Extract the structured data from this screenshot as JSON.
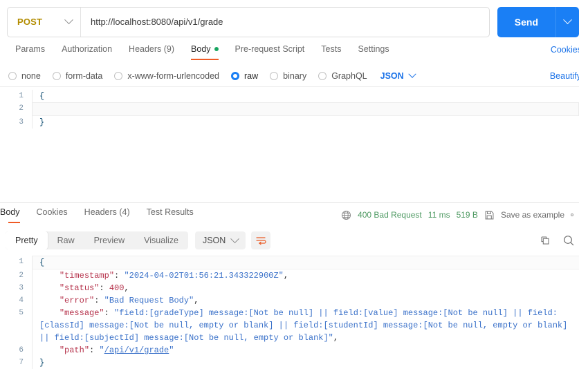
{
  "request": {
    "method": "POST",
    "url": "http://localhost:8080/api/v1/grade",
    "send_label": "Send",
    "tabs": [
      {
        "label": "Params",
        "active": false,
        "dot": false
      },
      {
        "label": "Authorization",
        "active": false,
        "dot": false
      },
      {
        "label": "Headers (9)",
        "active": false,
        "dot": false
      },
      {
        "label": "Body",
        "active": true,
        "dot": true
      },
      {
        "label": "Pre-request Script",
        "active": false,
        "dot": false
      },
      {
        "label": "Tests",
        "active": false,
        "dot": false
      },
      {
        "label": "Settings",
        "active": false,
        "dot": false
      }
    ],
    "cookies_link": "Cookies",
    "beautify_link": "Beautify",
    "body_types": [
      {
        "label": "none",
        "selected": false
      },
      {
        "label": "form-data",
        "selected": false
      },
      {
        "label": "x-www-form-urlencoded",
        "selected": false
      },
      {
        "label": "raw",
        "selected": true
      },
      {
        "label": "binary",
        "selected": false
      },
      {
        "label": "GraphQL",
        "selected": false
      }
    ],
    "raw_format": "JSON",
    "body_lines": [
      {
        "no": "1",
        "text": "{",
        "active": false
      },
      {
        "no": "2",
        "text": "",
        "active": true
      },
      {
        "no": "3",
        "text": "}",
        "active": false
      }
    ]
  },
  "response": {
    "tabs": [
      {
        "label": "Body",
        "active": true
      },
      {
        "label": "Cookies",
        "active": false
      },
      {
        "label": "Headers (4)",
        "active": false
      },
      {
        "label": "Test Results",
        "active": false
      }
    ],
    "status_text": "400 Bad Request",
    "time": "11 ms",
    "size": "519 B",
    "save_as_example": "Save as example",
    "view_modes": [
      {
        "label": "Pretty",
        "active": true
      },
      {
        "label": "Raw",
        "active": false
      },
      {
        "label": "Preview",
        "active": false
      },
      {
        "label": "Visualize",
        "active": false
      }
    ],
    "format": "JSON",
    "lines": [
      {
        "no": "1"
      },
      {
        "no": "2"
      },
      {
        "no": "3"
      },
      {
        "no": "4"
      },
      {
        "no": "5"
      },
      {
        "no": "6"
      },
      {
        "no": "7"
      }
    ],
    "json": {
      "open_brace": "{",
      "close_brace": "}",
      "timestamp_key": "\"timestamp\"",
      "timestamp_value": "\"2024-04-02T01:56:21.343322900Z\"",
      "status_key": "\"status\"",
      "status_value": "400",
      "error_key": "\"error\"",
      "error_value": "\"Bad Request Body\"",
      "message_key": "\"message\"",
      "message_value": "\"field:[gradeType] message:[Not be null] || field:[value] message:[Not be null] || field:[classId] message:[Not be null, empty or blank] || field:[studentId] message:[Not be null, empty or blank] || field:[subjectId] message:[Not be null, empty or blank]\"",
      "path_key": "\"path\"",
      "path_value": "/api/v1/grade",
      "quote": "\"",
      "colon": ": ",
      "comma": ","
    }
  },
  "icons": {
    "globe": "globe-icon",
    "save": "floppy-disk-icon",
    "copy": "copy-icon",
    "search": "search-icon",
    "wrap": "wrap-lines-icon"
  },
  "colors": {
    "accent_blue": "#1a7ff5",
    "link_blue": "#1a72e8",
    "tab_underline": "#ef5b25",
    "method_orange": "#b28c00",
    "status_green": "#4f9a63",
    "dot_green": "#17a560"
  }
}
